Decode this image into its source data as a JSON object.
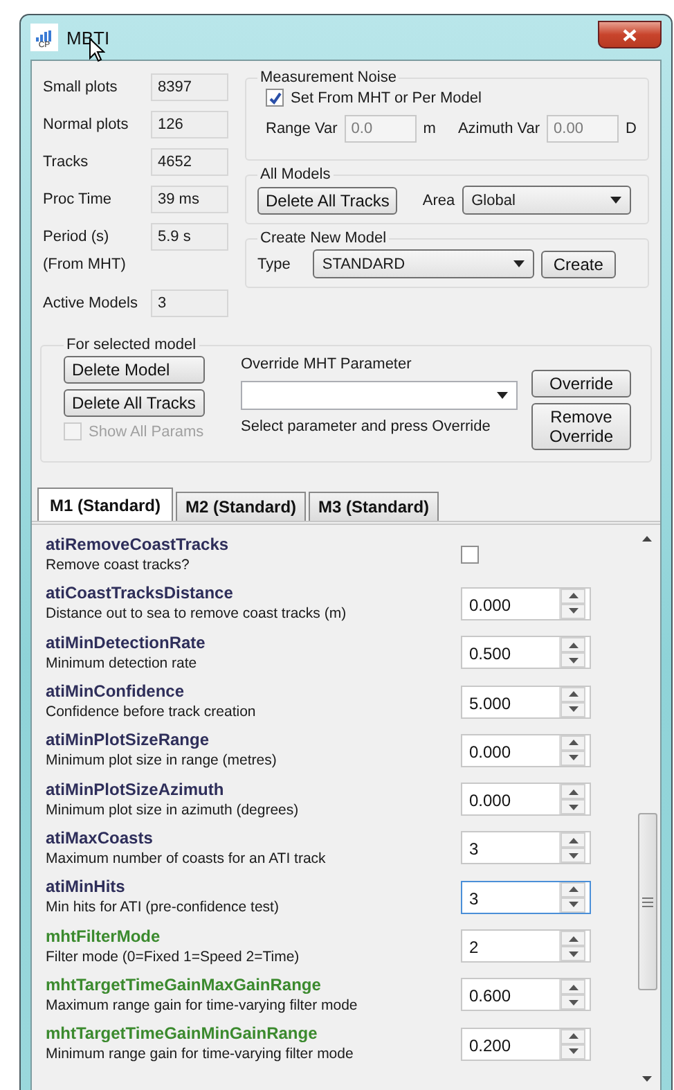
{
  "window": {
    "title": "MBTI",
    "icon_text": "CP"
  },
  "stats": [
    {
      "label": "Small plots",
      "value": "8397"
    },
    {
      "label": "Normal plots",
      "value": "126"
    },
    {
      "label": "Tracks",
      "value": "4652"
    },
    {
      "label": "Proc Time",
      "value": "39 ms"
    },
    {
      "label": "Period (s)",
      "value": "5.9 s",
      "note": "(From MHT)"
    },
    {
      "label": "Active Models",
      "value": "3"
    }
  ],
  "measurement_noise": {
    "title": "Measurement Noise",
    "checkbox": {
      "label": "Set From MHT or Per Model",
      "checked": true
    },
    "range_var": {
      "label": "Range Var",
      "value": "0.0",
      "unit": "m",
      "disabled": true
    },
    "azimuth_var": {
      "label": "Azimuth Var",
      "value": "0.00",
      "unit": "D",
      "disabled": true
    }
  },
  "all_models": {
    "title": "All Models",
    "button": "Delete All Tracks",
    "area_label": "Area",
    "area_value": "Global"
  },
  "create_model": {
    "title": "Create New Model",
    "type_label": "Type",
    "type_value": "STANDARD",
    "button": "Create"
  },
  "selected_model": {
    "title": "For selected model",
    "buttons": [
      "Delete Model",
      "Delete All Tracks"
    ],
    "show_all": {
      "label": "Show All Params",
      "checked": false,
      "disabled": true
    },
    "override_label": "Override MHT Parameter",
    "override_hint": "Select parameter and press Override",
    "override_button": "Override",
    "remove_button": "Remove Override"
  },
  "tabs": [
    {
      "label": "M1 (Standard)",
      "selected": true
    },
    {
      "label": "M2 (Standard)",
      "selected": false
    },
    {
      "label": "M3 (Standard)",
      "selected": false
    }
  ],
  "params": [
    {
      "name": "atiRemoveCoastTracks",
      "description": "Remove coast tracks?",
      "kind": "checkbox",
      "checked": false,
      "color": "#2e2e5a"
    },
    {
      "name": "atiCoastTracksDistance",
      "description": "Distance out to sea to remove coast tracks (m)",
      "kind": "number",
      "value": "0.000",
      "focused": false,
      "color": "#2e2e5a"
    },
    {
      "name": "atiMinDetectionRate",
      "description": "Minimum detection rate",
      "kind": "number",
      "value": "0.500",
      "focused": false,
      "color": "#2e2e5a"
    },
    {
      "name": "atiMinConfidence",
      "description": "Confidence before track creation",
      "kind": "number",
      "value": "5.000",
      "focused": false,
      "color": "#2e2e5a"
    },
    {
      "name": "atiMinPlotSizeRange",
      "description": "Minimum plot size in range (metres)",
      "kind": "number",
      "value": "0.000",
      "focused": false,
      "color": "#2e2e5a"
    },
    {
      "name": "atiMinPlotSizeAzimuth",
      "description": "Minimum plot size in azimuth (degrees)",
      "kind": "number",
      "value": "0.000",
      "focused": false,
      "color": "#2e2e5a"
    },
    {
      "name": "atiMaxCoasts",
      "description": "Maximum number of coasts for an ATI track",
      "kind": "number",
      "value": "3",
      "focused": false,
      "color": "#2e2e5a"
    },
    {
      "name": "atiMinHits",
      "description": "Min hits for ATI (pre-confidence test)",
      "kind": "number",
      "value": "3",
      "focused": true,
      "color": "#2e2e5a"
    },
    {
      "name": "mhtFilterMode",
      "description": "Filter mode (0=Fixed 1=Speed 2=Time)",
      "kind": "number",
      "value": "2",
      "focused": false,
      "color": "#3b8a2e"
    },
    {
      "name": "mhtTargetTimeGainMaxGainRange",
      "description": "Maximum range gain for time-varying filter mode",
      "kind": "number",
      "value": "0.600",
      "focused": false,
      "color": "#3b8a2e"
    },
    {
      "name": "mhtTargetTimeGainMinGainRange",
      "description": "Minimum range gain for time-varying filter mode",
      "kind": "number",
      "value": "0.200",
      "focused": false,
      "color": "#3b8a2e"
    }
  ]
}
